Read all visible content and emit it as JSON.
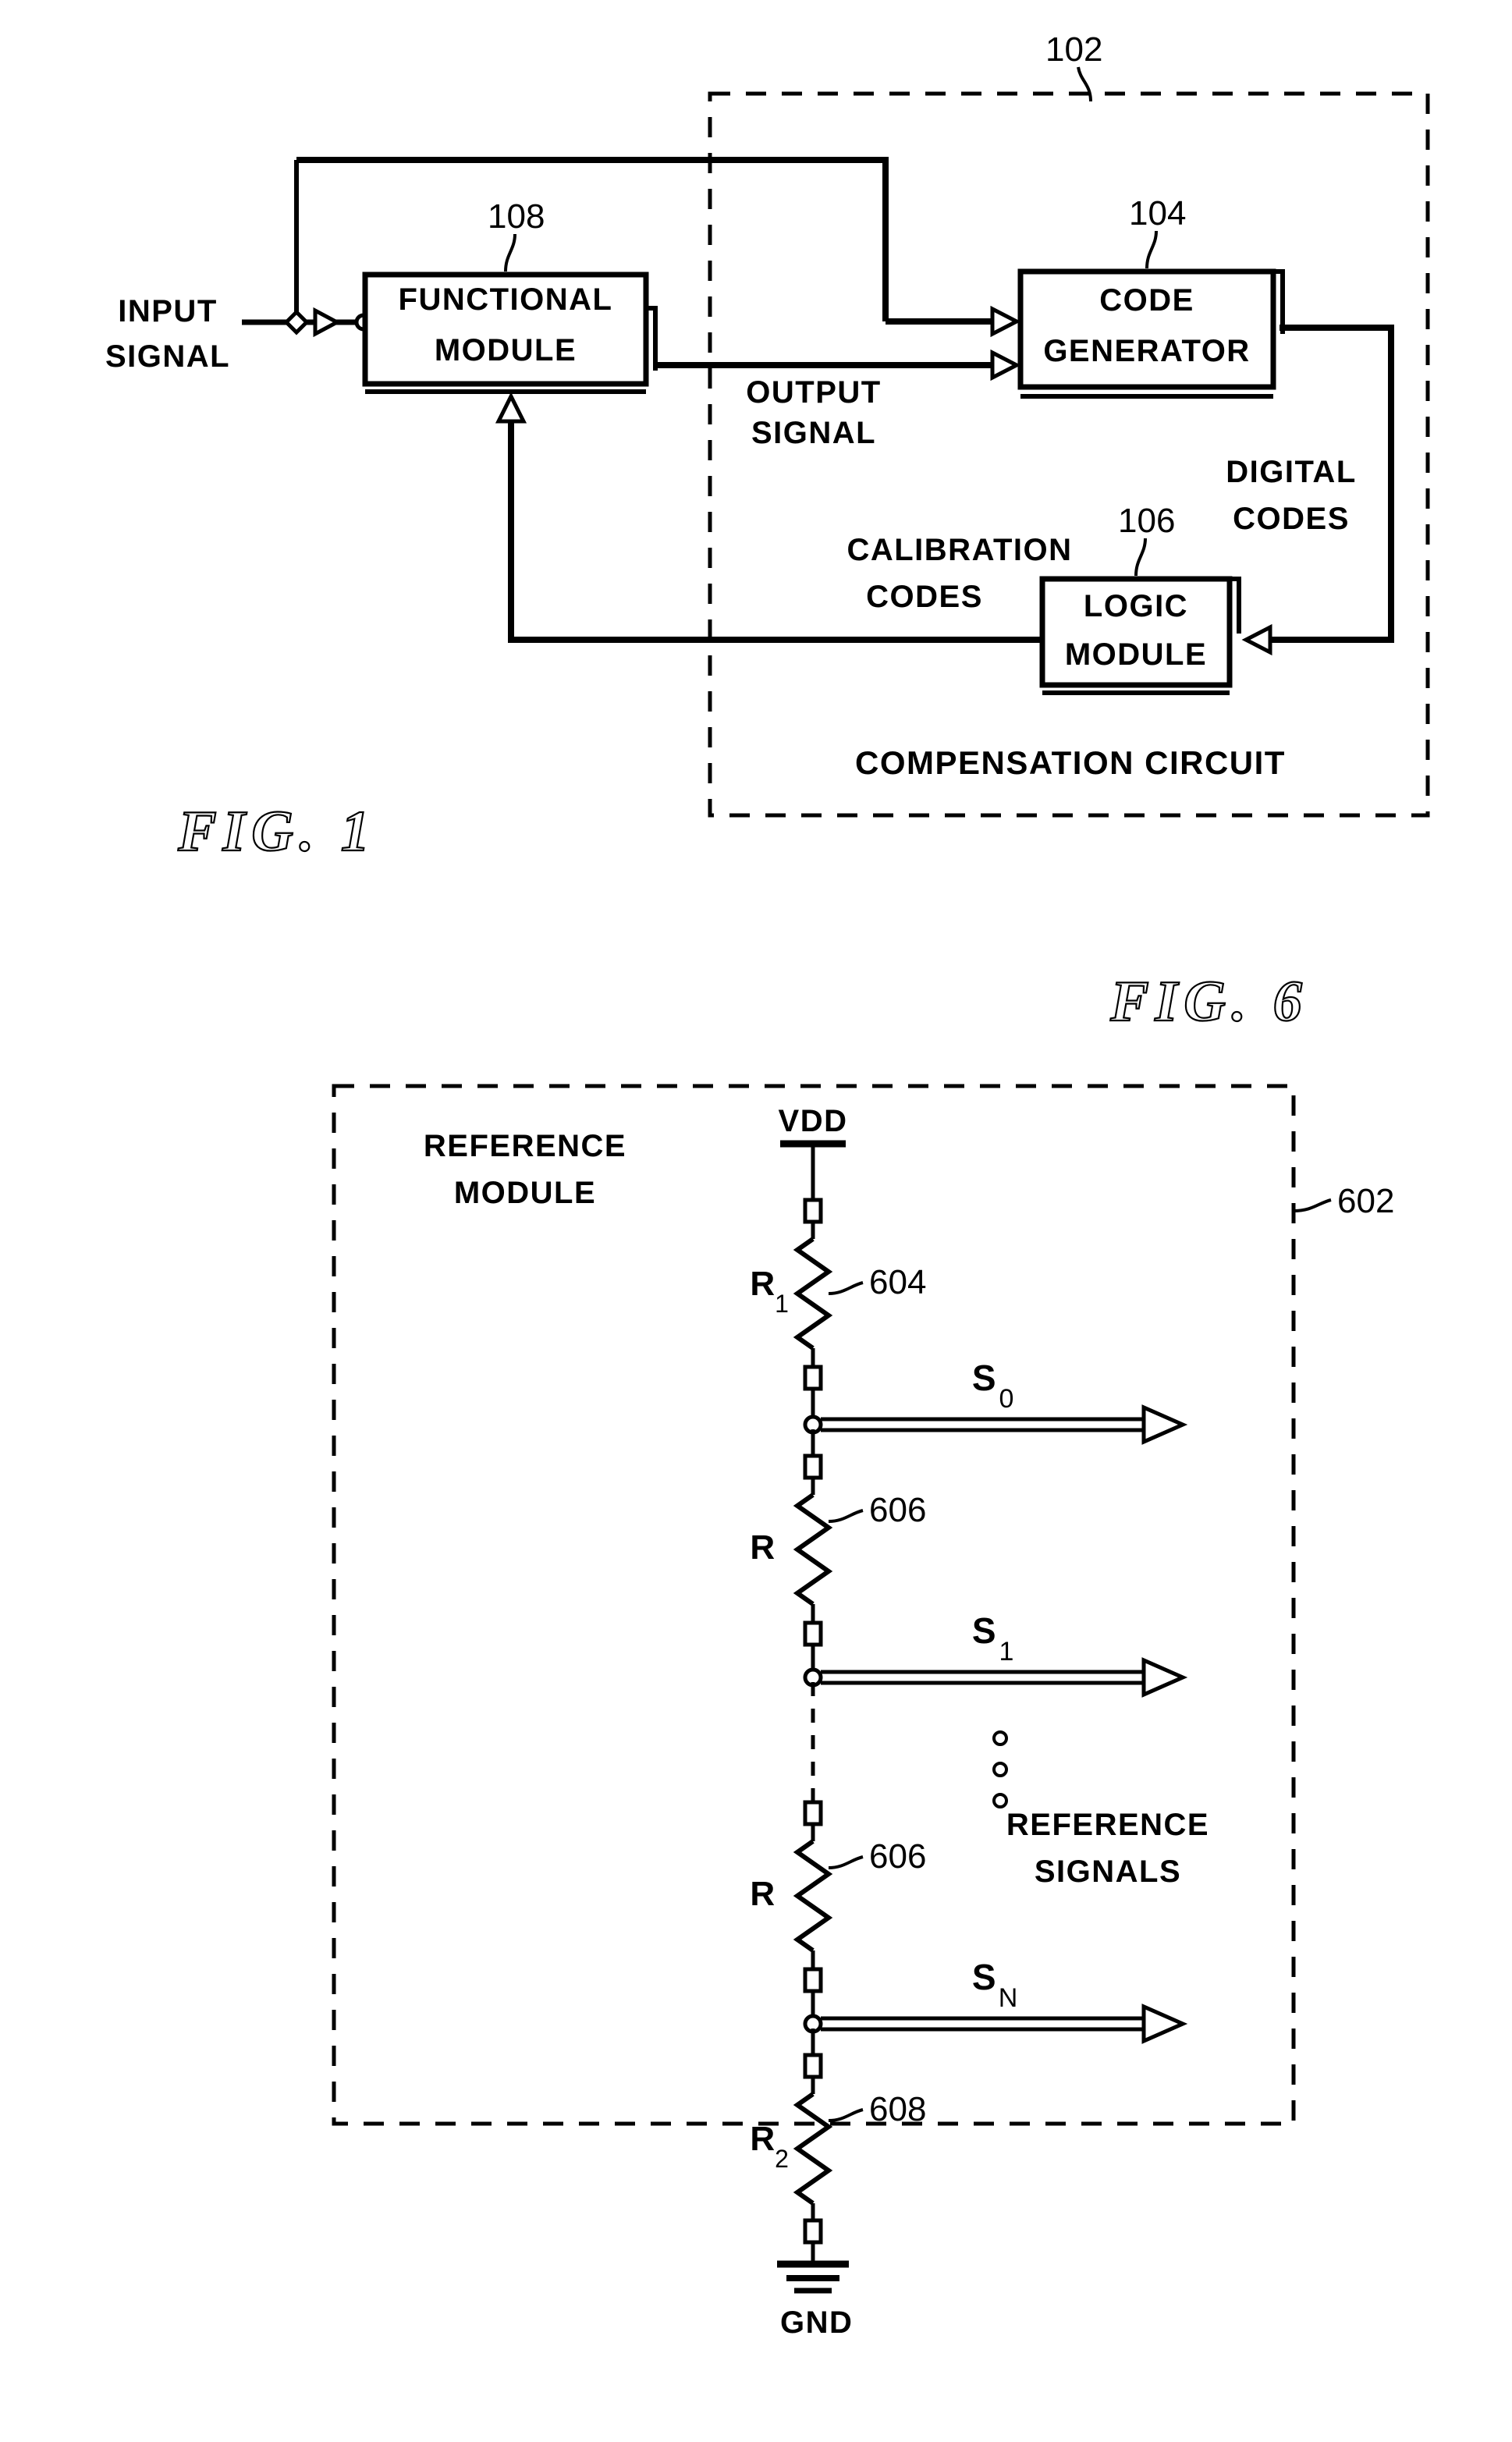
{
  "sheet": {
    "background_color": "#ffffff",
    "ink_color": "#000000"
  },
  "figures": [
    {
      "id": "fig1",
      "title": "FIG. 1",
      "caption_ref": "102",
      "dashed_boundary_label": "COMPENSATION CIRCUIT",
      "blocks": [
        {
          "ref": "108",
          "label_line1": "FUNCTIONAL",
          "label_line2": "MODULE"
        },
        {
          "ref": "104",
          "label_line1": "CODE",
          "label_line2": "GENERATOR"
        },
        {
          "ref": "106",
          "label_line1": "LOGIC",
          "label_line2": "MODULE"
        }
      ],
      "signals": [
        {
          "name": "input-signal",
          "line1": "INPUT",
          "line2": "SIGNAL"
        },
        {
          "name": "output-signal",
          "line1": "OUTPUT",
          "line2": "SIGNAL"
        },
        {
          "name": "digital-codes",
          "line1": "DIGITAL",
          "line2": "CODES"
        },
        {
          "name": "calibration-codes",
          "line1": "CALIBRATION",
          "line2": "CODES"
        }
      ]
    },
    {
      "id": "fig6",
      "title": "FIG. 6",
      "caption_ref": "602",
      "dashed_boundary_label_line1": "REFERENCE",
      "dashed_boundary_label_line2": "MODULE",
      "rails": {
        "top": "VDD",
        "bottom": "GND"
      },
      "resistors": [
        {
          "ref": "604",
          "designator": "R",
          "subscript": "1"
        },
        {
          "ref": "606",
          "designator": "R",
          "subscript": ""
        },
        {
          "ref": "606",
          "designator": "R",
          "subscript": ""
        },
        {
          "ref": "608",
          "designator": "R",
          "subscript": "2"
        }
      ],
      "taps": [
        {
          "designator": "S",
          "subscript": "0"
        },
        {
          "designator": "S",
          "subscript": "1"
        },
        {
          "designator": "S",
          "subscript": "N"
        }
      ],
      "output_group_label_line1": "REFERENCE",
      "output_group_label_line2": "SIGNALS",
      "vertical_ellipsis": "○ ○ ○"
    }
  ]
}
